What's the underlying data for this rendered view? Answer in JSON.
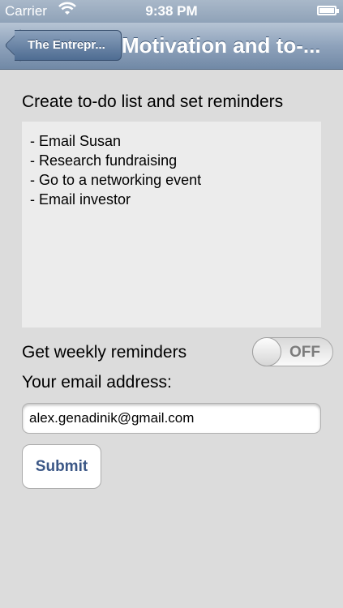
{
  "status_bar": {
    "carrier": "Carrier",
    "time": "9:38 PM"
  },
  "nav": {
    "back_label": "The Entrepr...",
    "title": "Motivation and to-..."
  },
  "todo": {
    "heading": "Create to-do list and set reminders",
    "items": [
      "- Email Susan",
      "- Research fundraising",
      "- Go to a networking event",
      "- Email investor"
    ]
  },
  "reminders": {
    "label": "Get weekly reminders",
    "toggle_state": "OFF"
  },
  "email": {
    "label": "Your email address:",
    "value": "alex.genadinik@gmail.com"
  },
  "submit": {
    "label": "Submit"
  },
  "colors": {
    "nav_bar": "#8ea2bb",
    "background": "#dcdcdc",
    "submit_text": "#3b5786"
  }
}
